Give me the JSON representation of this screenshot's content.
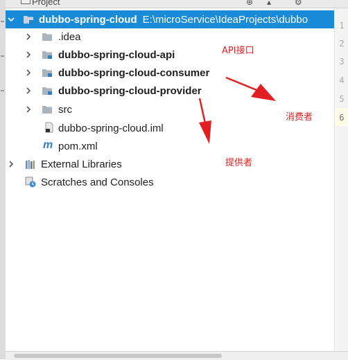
{
  "window": {
    "tab_title": "Project",
    "accent_color": "#1a8bd6"
  },
  "tree": {
    "root": {
      "name": "dubbo-spring-cloud",
      "path": "E:\\microService\\IdeaProjects\\dubbo",
      "icon": "module-folder-icon"
    },
    "children": [
      {
        "label": ".idea",
        "icon": "folder-icon",
        "expandable": true,
        "bold": false
      },
      {
        "label": "dubbo-spring-cloud-api",
        "icon": "module-folder-icon",
        "expandable": true,
        "bold": true
      },
      {
        "label": "dubbo-spring-cloud-consumer",
        "icon": "module-folder-icon",
        "expandable": true,
        "bold": true
      },
      {
        "label": "dubbo-spring-cloud-provider",
        "icon": "module-folder-icon",
        "expandable": true,
        "bold": true
      },
      {
        "label": "src",
        "icon": "folder-icon",
        "expandable": true,
        "bold": false
      },
      {
        "label": "dubbo-spring-cloud.iml",
        "icon": "iml-file-icon",
        "expandable": false,
        "bold": false
      },
      {
        "label": "pom.xml",
        "icon": "maven-icon",
        "expandable": false,
        "bold": false
      }
    ],
    "external_libraries": "External Libraries",
    "scratches": "Scratches and Consoles"
  },
  "gutter": {
    "line_numbers": [
      "1",
      "2",
      "3",
      "4",
      "5",
      "6"
    ],
    "active_line": "6"
  },
  "annotations": {
    "api": "API接口",
    "consumer": "消费者",
    "provider": "提供者",
    "color": "#e02020"
  }
}
